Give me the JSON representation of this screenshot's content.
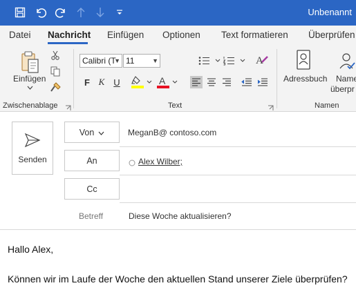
{
  "window": {
    "title": "Unbenannt"
  },
  "menu": {
    "tabs": [
      {
        "label": "Datei"
      },
      {
        "label": "Nachricht"
      },
      {
        "label": "Einfügen"
      },
      {
        "label": "Optionen"
      },
      {
        "label": "Text formatieren"
      },
      {
        "label": "Überprüfen"
      }
    ],
    "active": "Nachricht"
  },
  "ribbon": {
    "clipboard": {
      "paste_label": "Einfügen",
      "group_label": "Zwischenablage"
    },
    "text": {
      "font_name": "Calibri (T",
      "font_size": "11",
      "bold": "F",
      "italic": "K",
      "underline": "U",
      "highlight_color": "#ffff00",
      "font_color": "#e81123",
      "group_label": "Text"
    },
    "names": {
      "addressbook_label": "Adressbuch",
      "check_names_label_1": "Name",
      "check_names_label_2": "überpr",
      "group_label": "Namen"
    }
  },
  "compose": {
    "send_label": "Senden",
    "from_label": "Von",
    "from_value": "MeganB@ contoso.com",
    "to_label": "An",
    "to_value": "Alex Wilber;",
    "cc_label": "Cc",
    "cc_value": "",
    "subject_label": "Betreff",
    "subject_value": "Diese Woche aktualisieren?",
    "body_lines": [
      "Hallo Alex,",
      "Können wir im Laufe der Woche den aktuellen Stand unserer Ziele überprüfen?"
    ]
  },
  "colors": {
    "accent": "#2b66c4"
  }
}
